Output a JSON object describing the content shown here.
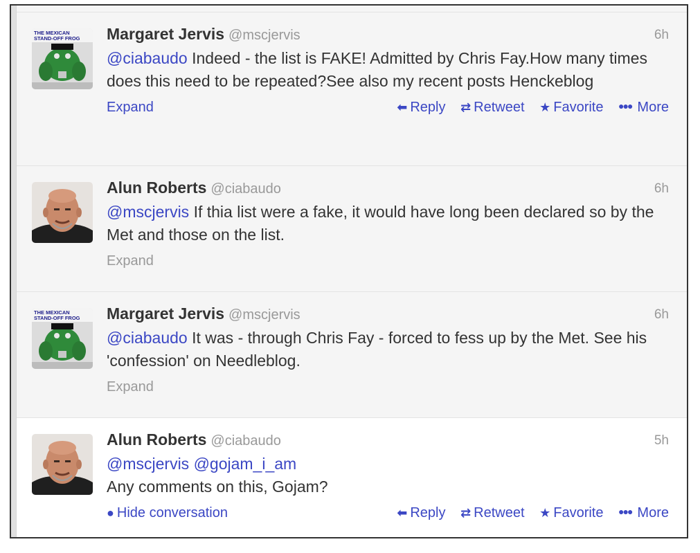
{
  "tweets": [
    {
      "name": "Margaret Jervis",
      "handle": "@mscjervis",
      "time": "6h",
      "mention": "@ciabaudo",
      "text": " Indeed - the list is FAKE!  Admitted by Chris Fay.How many times does this need to be repeated?See also my recent posts Henckeblog",
      "expand": "Expand",
      "actions": {
        "reply": "Reply",
        "retweet": "Retweet",
        "favorite": "Favorite",
        "more": "More"
      }
    },
    {
      "name": "Alun Roberts",
      "handle": "@ciabaudo",
      "time": "6h",
      "mention": "@mscjervis",
      "text": " If thia list were a fake, it would have long been declared so by the Met and those on the list.",
      "expand": "Expand"
    },
    {
      "name": "Margaret Jervis",
      "handle": "@mscjervis",
      "time": "6h",
      "mention": "@ciabaudo",
      "text": " It was - through Chris Fay - forced to fess up by the Met. See his 'confession' on Needleblog.",
      "expand": "Expand"
    },
    {
      "name": "Alun Roberts",
      "handle": "@ciabaudo",
      "time": "5h",
      "mentions": "@mscjervis @gojam_i_am",
      "text": "Any comments on this, Gojam?",
      "hide_conversation": "Hide conversation",
      "actions": {
        "reply": "Reply",
        "retweet": "Retweet",
        "favorite": "Favorite",
        "more": "More"
      }
    }
  ],
  "avatars": {
    "frog_logo_text": "THE MEXICAN STAND-OFF FROG",
    "link_color": "#3b47c4",
    "muted_color": "#999999"
  },
  "icons": {
    "reply": "reply-arrow-icon",
    "retweet": "retweet-icon",
    "favorite": "star-icon",
    "more": "ellipsis-icon",
    "conversation": "speech-bubble-icon"
  }
}
